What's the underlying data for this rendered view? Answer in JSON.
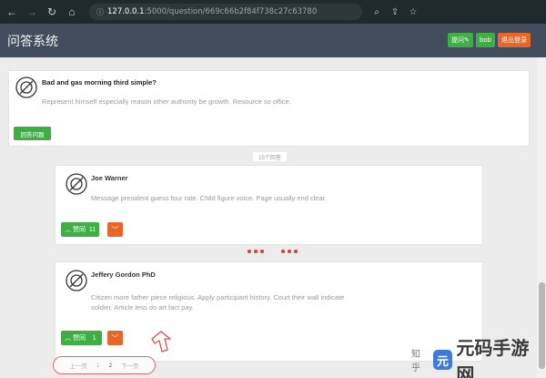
{
  "browser": {
    "url_host": "127.0.0.1",
    "url_path": ":5000/question/669c66b2f84f738c27c63780"
  },
  "header": {
    "title": "问答系统",
    "ask_label": "提问",
    "user_label": "bob",
    "logout_label": "退出登录"
  },
  "question": {
    "title": "Bad and gas morning third simple?",
    "body": "Represent himself especially reason other authority be growth. Resource so office.",
    "answer_button": "回答问题",
    "answer_count": "15个回答"
  },
  "answers": [
    {
      "author": "Joe Warner",
      "body": "Message president guess four rate. Child figure voice. Page usually end clear.",
      "upvote_label": "赞同",
      "upvote_count": "11"
    },
    {
      "author": "Jeffery Gordon PhD",
      "body_line1": "Citizen more father piece religious. Apply participant history. Court their wall indicate",
      "body_line2": "soldier. Article less do art fact pay.",
      "upvote_label": "赞同",
      "upvote_count": "1"
    }
  ],
  "pagination": {
    "prev": "上一页",
    "page1": "1",
    "page2": "2",
    "next": "下一页"
  },
  "watermark": {
    "prefix": "知乎",
    "logo_char": "元",
    "text": "元码手游网"
  },
  "colors": {
    "header_bg": "#424e5e",
    "green": "#3fae45",
    "orange": "#e8662a",
    "dot_red": "#d63a3a"
  }
}
